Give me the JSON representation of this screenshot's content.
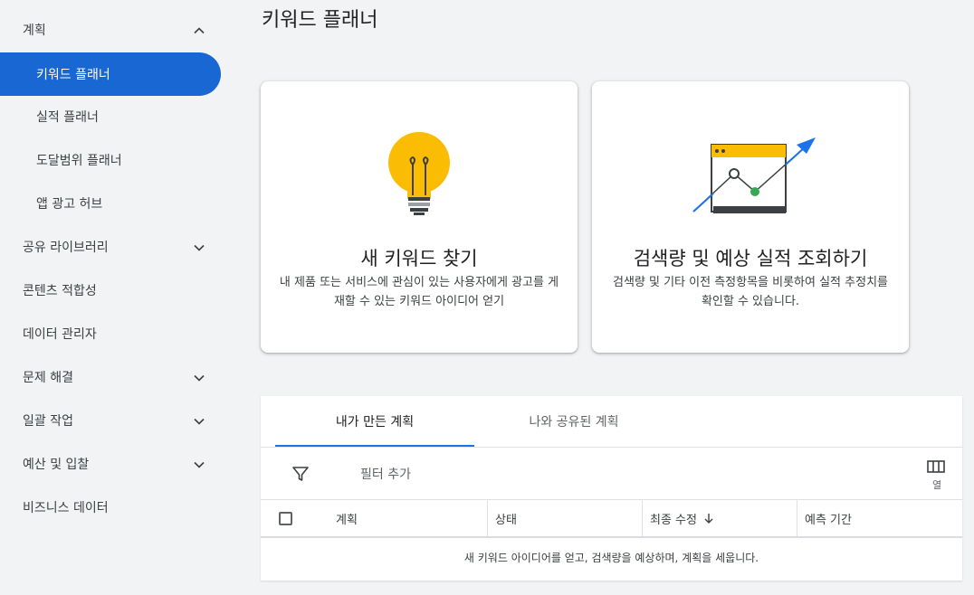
{
  "page_title": "키워드 플래너",
  "sidebar": {
    "items": [
      {
        "label": "계획",
        "level": "top",
        "expanded": true
      },
      {
        "label": "키워드 플래너",
        "level": "sub",
        "active": true
      },
      {
        "label": "실적 플래너",
        "level": "sub"
      },
      {
        "label": "도달범위 플래너",
        "level": "sub"
      },
      {
        "label": "앱 광고 허브",
        "level": "sub"
      },
      {
        "label": "공유 라이브러리",
        "level": "top",
        "expandable": true
      },
      {
        "label": "콘텐츠 적합성",
        "level": "top"
      },
      {
        "label": "데이터 관리자",
        "level": "top"
      },
      {
        "label": "문제 해결",
        "level": "top",
        "expandable": true
      },
      {
        "label": "일괄 작업",
        "level": "top",
        "expandable": true
      },
      {
        "label": "예산 및 입찰",
        "level": "top",
        "expandable": true
      },
      {
        "label": "비즈니스 데이터",
        "level": "top"
      }
    ]
  },
  "cards": [
    {
      "title": "새 키워드 찾기",
      "description": "내 제품 또는 서비스에 관심이 있는 사용자에게 광고를 게재할 수 있는 키워드 아이디어 얻기",
      "icon": "lightbulb-icon"
    },
    {
      "title": "검색량 및 예상 실적 조회하기",
      "description": "검색량 및 기타 이전 측정항목을 비롯하여 실적 추정치를 확인할 수 있습니다.",
      "icon": "trend-chart-icon"
    }
  ],
  "plans": {
    "tabs": [
      {
        "label": "내가 만든 계획",
        "active": true
      },
      {
        "label": "나와 공유된 계획",
        "active": false
      }
    ],
    "filter_placeholder": "필터 추가",
    "columns_label": "열",
    "table_headers": [
      "계획",
      "상태",
      "최종 수정",
      "예측 기간"
    ],
    "sort_column": "최종 수정",
    "empty_message": "새 키워드 아이디어를 얻고, 검색량을 예상하며, 계획을 세웁니다."
  },
  "colors": {
    "accent": "#1a73e8",
    "active_nav": "#1967d2",
    "bulb": "#fbbc04",
    "chart_point": "#34a853"
  }
}
